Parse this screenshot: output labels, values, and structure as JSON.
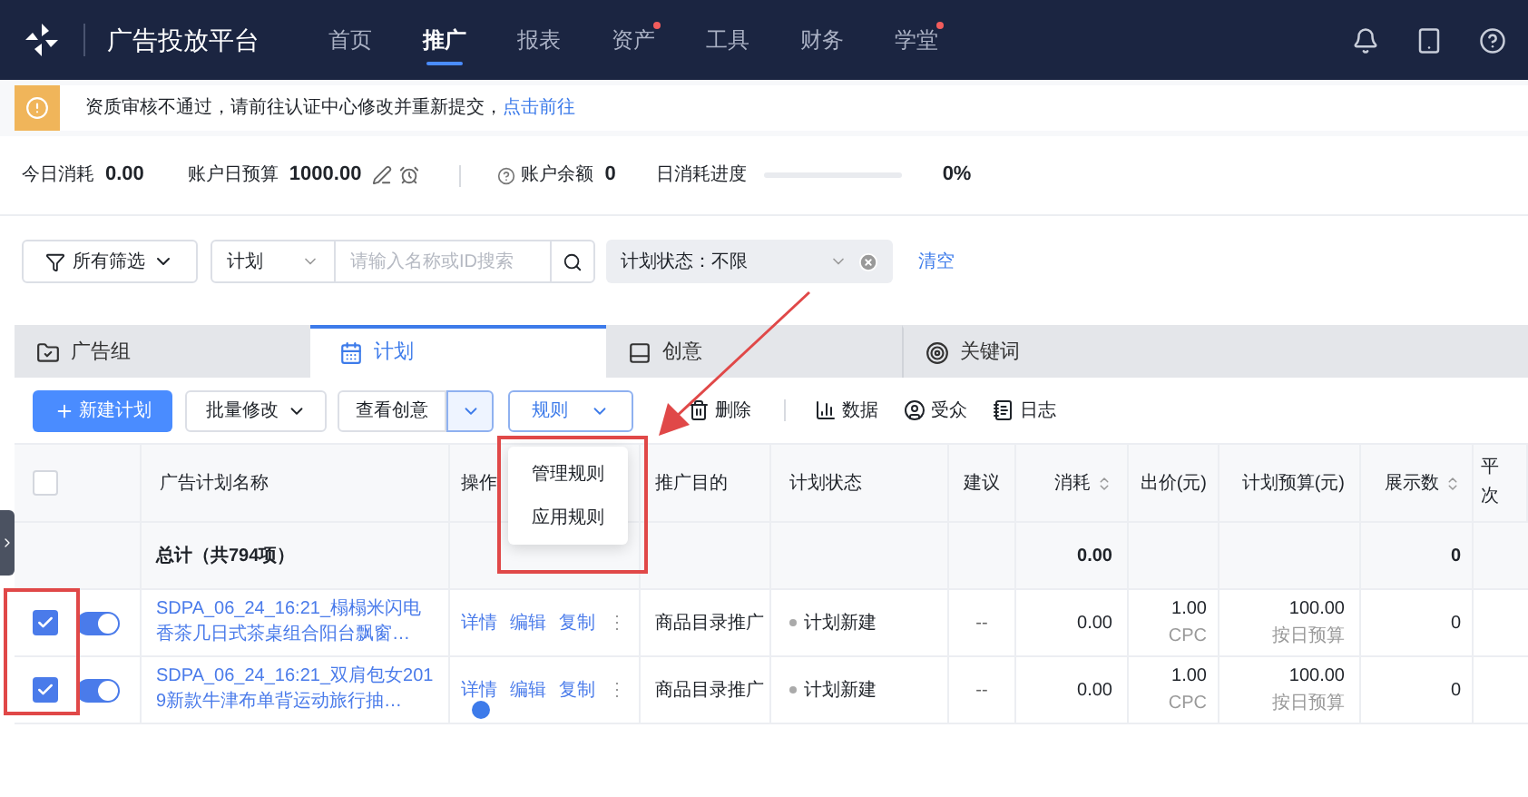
{
  "nav": {
    "title": "广告投放平台",
    "items": [
      {
        "label": "首页",
        "selected": false,
        "dot": false
      },
      {
        "label": "推广",
        "selected": true,
        "dot": false
      },
      {
        "label": "报表",
        "selected": false,
        "dot": false
      },
      {
        "label": "资产",
        "selected": false,
        "dot": true
      },
      {
        "label": "工具",
        "selected": false,
        "dot": false
      },
      {
        "label": "财务",
        "selected": false,
        "dot": false
      },
      {
        "label": "学堂",
        "selected": false,
        "dot": true
      }
    ]
  },
  "alert": {
    "message": "资质审核不通过，请前往认证中心修改并重新提交，",
    "link": "点击前往"
  },
  "stats": {
    "today_spend_label": "今日消耗",
    "today_spend": "0.00",
    "daily_budget_label": "账户日预算",
    "daily_budget": "1000.00",
    "balance_label": "账户余额",
    "balance": "0",
    "progress_label": "日消耗进度",
    "progress": {
      "level": 0
    },
    "progress_reading": "0%"
  },
  "filters": {
    "all_filters": "所有筛选",
    "scope": "计划",
    "search": {
      "placeholder": "请输入名称或ID搜索"
    },
    "status_chip": "计划状态：不限",
    "clear": "清空"
  },
  "tabs": [
    {
      "label": "广告组",
      "selected": false
    },
    {
      "label": "计划",
      "selected": true
    },
    {
      "label": "创意",
      "selected": false
    },
    {
      "label": "关键词",
      "selected": false
    }
  ],
  "toolbar": {
    "new": "新建计划",
    "batch": "批量修改",
    "view_creative": "查看创意",
    "rules": "规则",
    "delete": "删除",
    "data": "数据",
    "audience": "受众",
    "log": "日志"
  },
  "rules_menu": [
    "管理规则",
    "应用规则"
  ],
  "table": {
    "columns": [
      {
        "label": "广告计划名称",
        "sortable": false
      },
      {
        "label": "操作",
        "sortable": false
      },
      {
        "label": "推广目的",
        "sortable": false
      },
      {
        "label": "计划状态",
        "sortable": false
      },
      {
        "label": "建议",
        "sortable": false
      },
      {
        "label": "消耗",
        "sortable": true
      },
      {
        "label": "出价(元)",
        "sortable": false
      },
      {
        "label": "计划预算(元)",
        "sortable": false
      },
      {
        "label": "展示数",
        "sortable": true
      },
      {
        "label": "平次",
        "sortable": false
      }
    ],
    "header_checked": false,
    "total": {
      "label": "总计（共794项）",
      "spend": "0.00",
      "impressions": "0"
    },
    "rows": [
      {
        "checked": true,
        "on": true,
        "name": "SDPA_06_24_16:21_榻榻米闪电香茶几日式茶桌组合阳台飘窗…",
        "actions": [
          "详情",
          "编辑",
          "复制",
          "⋮"
        ],
        "purpose": "商品目录推广",
        "status": "计划新建",
        "suggestion": "--",
        "spend": "0.00",
        "bid": "1.00",
        "bid_type": "CPC",
        "budget": "100.00",
        "budget_type": "按日预算",
        "impressions": "0"
      },
      {
        "checked": true,
        "on": true,
        "name": "SDPA_06_24_16:21_双肩包女2019新款牛津布单背运动旅行抽…",
        "actions": [
          "详情",
          "编辑",
          "复制",
          "⋮"
        ],
        "purpose": "商品目录推广",
        "status": "计划新建",
        "suggestion": "--",
        "spend": "0.00",
        "bid": "1.00",
        "bid_type": "CPC",
        "budget": "100.00",
        "budget_type": "按日预算",
        "impressions": "0"
      }
    ]
  }
}
